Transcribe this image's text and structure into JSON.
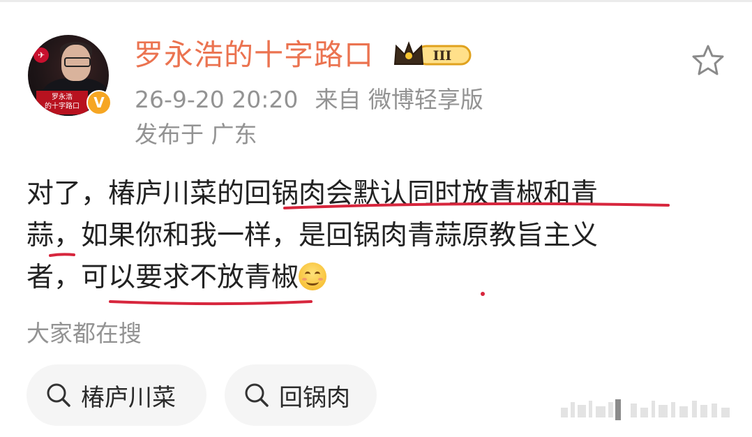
{
  "post": {
    "author": "罗永浩的十字路口",
    "level_badge": "III",
    "timestamp": "26-9-20 20:20",
    "source": "来自 微博轻享版",
    "location": "发布于 广东",
    "avatar_caption_line1": "罗永浩",
    "avatar_caption_line2": "的十字路口",
    "verified_mark": "V",
    "text_lines": [
      "对了，椿庐川菜的回锅肉会默认同时放青椒和青",
      "蒜，如果你和我一样，是回锅肉青蒜原教旨主义",
      "者，可以要求不放青椒"
    ],
    "emoji": "smiling-face"
  },
  "search": {
    "title": "大家都在搜",
    "chips": [
      "椿庐川菜",
      "回锅肉"
    ]
  },
  "colors": {
    "username": "#eb7350",
    "meta_text": "#939393",
    "body_text": "#222222",
    "underline": "#d7263d",
    "chip_bg": "#f5f5f5",
    "verified": "#f6a623"
  },
  "icons": [
    "favorite-star-icon",
    "search-icon",
    "crown-icon",
    "verified-icon"
  ]
}
